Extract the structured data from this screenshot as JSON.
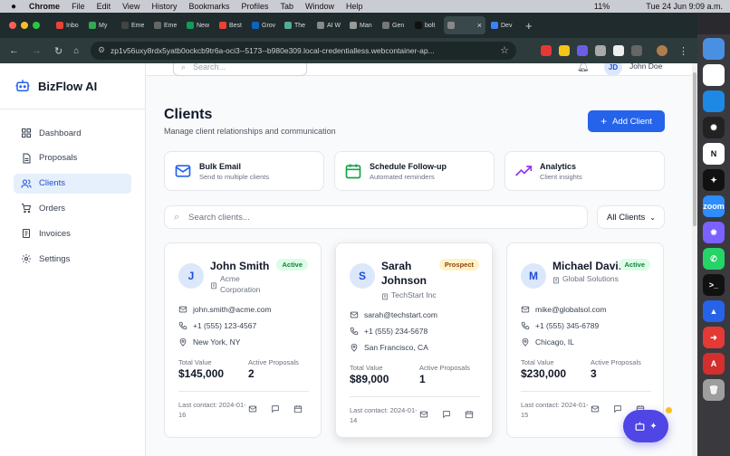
{
  "os_menu": {
    "app": "Chrome",
    "items": [
      "File",
      "Edit",
      "View",
      "History",
      "Bookmarks",
      "Profiles",
      "Tab",
      "Window",
      "Help"
    ],
    "battery": "11%",
    "clock": "Tue 24 Jun  9:09 a.m."
  },
  "browser": {
    "tabs": [
      {
        "label": "Inbo",
        "color": "#ea4335"
      },
      {
        "label": "My",
        "color": "#34a853"
      },
      {
        "label": "Eme",
        "color": "#444"
      },
      {
        "label": "Eme",
        "color": "#666"
      },
      {
        "label": "New",
        "color": "#0f9d58"
      },
      {
        "label": "Best",
        "color": "#ea4335"
      },
      {
        "label": "Grov",
        "color": "#0a66c2"
      },
      {
        "label": "The",
        "color": "#5a9"
      },
      {
        "label": "AI W",
        "color": "#888"
      },
      {
        "label": "Man",
        "color": "#999"
      },
      {
        "label": "Gen",
        "color": "#777"
      },
      {
        "label": "bolt",
        "color": "#111"
      },
      {
        "label": "",
        "color": "#888"
      },
      {
        "label": "Dev",
        "color": "#3b82f6"
      }
    ],
    "url": "zp1v56uxy8rdx5yatb0ockcb9tr6a-oci3--5173--b980e309.local-credentialless.webcontainer-ap..."
  },
  "dock": [
    {
      "name": "finder",
      "color": "#4a90e2",
      "glyph": ""
    },
    {
      "name": "chrome",
      "color": "#fff",
      "glyph": ""
    },
    {
      "name": "safari",
      "color": "#1e88e5",
      "glyph": ""
    },
    {
      "name": "chatgpt",
      "color": "#222",
      "glyph": "✺"
    },
    {
      "name": "notion",
      "color": "#fff",
      "glyph": "N"
    },
    {
      "name": "perplexity",
      "color": "#111",
      "glyph": "✦"
    },
    {
      "name": "zoom",
      "color": "#2d8cff",
      "glyph": "zoom"
    },
    {
      "name": "settings",
      "color": "#7b61ff",
      "glyph": "✹"
    },
    {
      "name": "whatsapp",
      "color": "#25d366",
      "glyph": "✆"
    },
    {
      "name": "terminal",
      "color": "#111",
      "glyph": ">_"
    },
    {
      "name": "app-blue",
      "color": "#2563eb",
      "glyph": "▲"
    },
    {
      "name": "app-red",
      "color": "#e53935",
      "glyph": "➜"
    },
    {
      "name": "acrobat",
      "color": "#d32f2f",
      "glyph": "A"
    },
    {
      "name": "trash",
      "color": "#9e9e9e",
      "glyph": "🗑"
    }
  ],
  "app": {
    "brand": "BizFlow AI",
    "nav": [
      {
        "label": "Dashboard",
        "icon": "grid-icon"
      },
      {
        "label": "Proposals",
        "icon": "document-icon"
      },
      {
        "label": "Clients",
        "icon": "users-icon",
        "active": true
      },
      {
        "label": "Orders",
        "icon": "cart-icon"
      },
      {
        "label": "Invoices",
        "icon": "invoice-icon"
      },
      {
        "label": "Settings",
        "icon": "gear-icon"
      }
    ],
    "search_placeholder": "Search...",
    "user": {
      "initials": "JD",
      "name": "John Doe"
    },
    "page_title": "Clients",
    "page_subtitle": "Manage client relationships and communication",
    "add_button": "Add Client",
    "quick_actions": [
      {
        "title": "Bulk Email",
        "subtitle": "Send to multiple clients",
        "icon": "mail-icon",
        "color": "#2563eb"
      },
      {
        "title": "Schedule Follow-up",
        "subtitle": "Automated reminders",
        "icon": "calendar-icon",
        "color": "#16a34a"
      },
      {
        "title": "Analytics",
        "subtitle": "Client insights",
        "icon": "trend-icon",
        "color": "#9333ea"
      }
    ],
    "client_search_placeholder": "Search clients...",
    "filter": "All Clients",
    "clients": [
      {
        "initial": "J",
        "name": "John Smith",
        "company": "Acme Corporation",
        "status": "Active",
        "status_kind": "active",
        "email": "john.smith@acme.com",
        "phone": "+1 (555) 123-4567",
        "location": "New York, NY",
        "total_label": "Total Value",
        "total": "$145,000",
        "proposals_label": "Active Proposals",
        "proposals": "2",
        "last_contact": "Last contact: 2024-01-16"
      },
      {
        "initial": "S",
        "name": "Sarah Johnson",
        "company": "TechStart Inc",
        "status": "Prospect",
        "status_kind": "prospect",
        "email": "sarah@techstart.com",
        "phone": "+1 (555) 234-5678",
        "location": "San Francisco, CA",
        "total_label": "Total Value",
        "total": "$89,000",
        "proposals_label": "Active Proposals",
        "proposals": "1",
        "last_contact": "Last contact: 2024-01-14"
      },
      {
        "initial": "M",
        "name": "Michael Davis",
        "company": "Global Solutions",
        "status": "Active",
        "status_kind": "active",
        "email": "mike@globalsol.com",
        "phone": "+1 (555) 345-6789",
        "location": "Chicago, IL",
        "total_label": "Total Value",
        "total": "$230,000",
        "proposals_label": "Active Proposals",
        "proposals": "3",
        "last_contact": "Last contact: 2024-01-15"
      }
    ]
  }
}
